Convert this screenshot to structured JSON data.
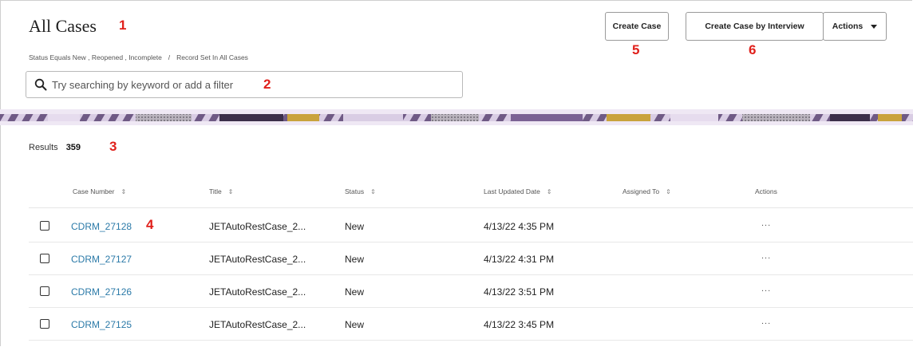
{
  "page": {
    "title": "All Cases",
    "breadcrumb": {
      "filter": "Status Equals New , Reopened , Incomplete",
      "separator": "/",
      "record_set": "Record Set In All Cases"
    }
  },
  "search": {
    "placeholder": "Try searching by keyword or add a filter",
    "value": "",
    "icon": "search-icon"
  },
  "toolbar": {
    "create_case": "Create Case",
    "create_case_interview": "Create Case by Interview",
    "actions": "Actions",
    "actions_icon": "caret-down-icon"
  },
  "results": {
    "label": "Results",
    "count": "359"
  },
  "table": {
    "columns": [
      "Case Number",
      "Title",
      "Status",
      "Last Updated Date",
      "Assigned To",
      "Actions"
    ],
    "sortable_icon": "sort-icon",
    "rows": [
      {
        "case_number": "CDRM_27128",
        "title": "JETAutoRestCase_2...",
        "status": "New",
        "updated": "4/13/22 4:35 PM",
        "assigned": "",
        "actions": "..."
      },
      {
        "case_number": "CDRM_27127",
        "title": "JETAutoRestCase_2...",
        "status": "New",
        "updated": "4/13/22 4:31 PM",
        "assigned": "",
        "actions": "..."
      },
      {
        "case_number": "CDRM_27126",
        "title": "JETAutoRestCase_2...",
        "status": "New",
        "updated": "4/13/22 3:51 PM",
        "assigned": "",
        "actions": "..."
      },
      {
        "case_number": "CDRM_27125",
        "title": "JETAutoRestCase_2...",
        "status": "New",
        "updated": "4/13/22 3:45 PM",
        "assigned": "",
        "actions": "..."
      }
    ]
  },
  "callouts": [
    "1",
    "2",
    "3",
    "4",
    "5",
    "6"
  ],
  "colors": {
    "accent_link": "#2b7aa8",
    "callout": "#e0201b",
    "band_purple": "#8a6d9e",
    "band_gold": "#c7a23a"
  }
}
